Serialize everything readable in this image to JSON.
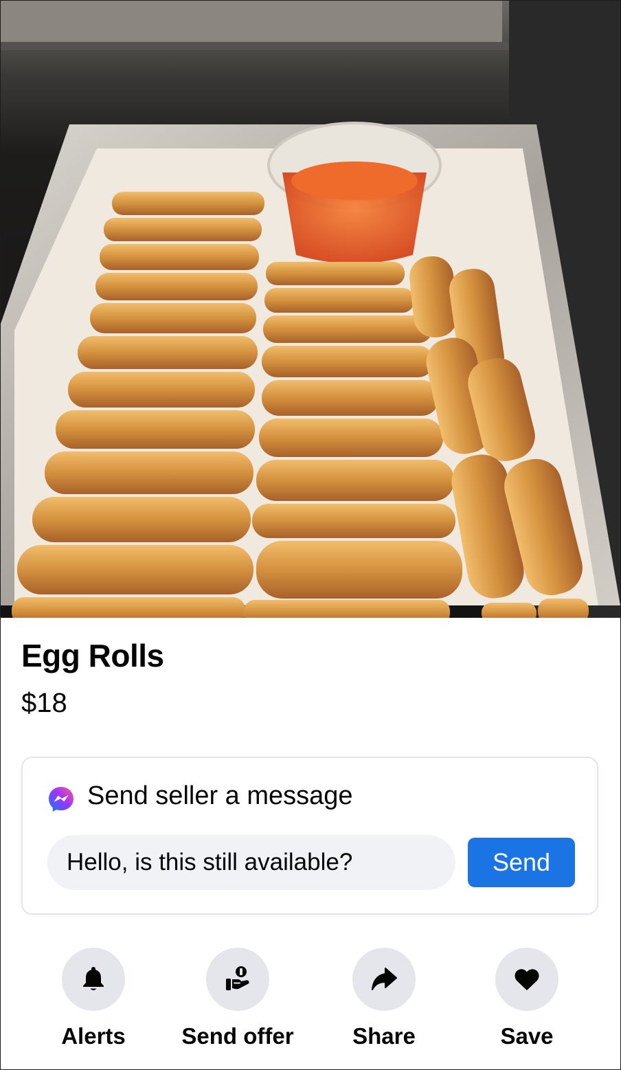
{
  "listing": {
    "title": "Egg Rolls",
    "price": "$18",
    "photo_alt": "Egg rolls in a foil tray"
  },
  "message": {
    "heading": "Send seller a message",
    "input_value": "Hello, is this still available?",
    "send_label": "Send",
    "icon": "messenger-icon"
  },
  "actions": [
    {
      "label": "Alerts",
      "icon": "bell-icon"
    },
    {
      "label": "Send offer",
      "icon": "offer-icon"
    },
    {
      "label": "Share",
      "icon": "share-icon"
    },
    {
      "label": "Save",
      "icon": "heart-icon"
    }
  ],
  "colors": {
    "accent": "#1b74e4",
    "button_gray": "#e4e6eb",
    "input_bg": "#f0f2f5",
    "text": "#050505"
  }
}
